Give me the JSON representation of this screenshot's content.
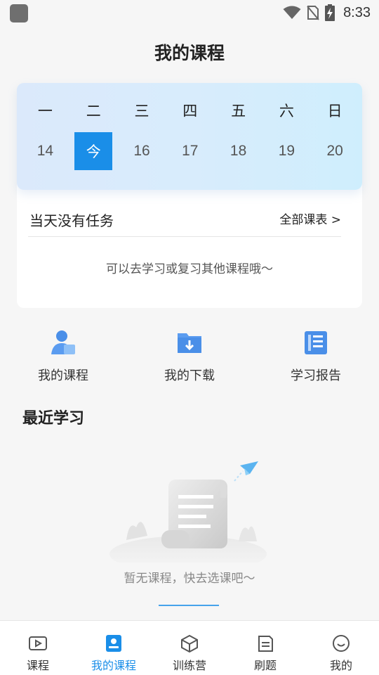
{
  "status_bar": {
    "time": "8:33"
  },
  "header": {
    "title": "我的课程"
  },
  "calendar": {
    "weekdays": [
      "一",
      "二",
      "三",
      "四",
      "五",
      "六",
      "日"
    ],
    "dates": [
      "14",
      "今",
      "16",
      "17",
      "18",
      "19",
      "20"
    ],
    "selected_index": 1
  },
  "task": {
    "title": "当天没有任务",
    "all_link": "全部课表 >",
    "hint": "可以去学习或复习其他课程哦～"
  },
  "quick_links": [
    {
      "label": "我的课程",
      "icon": "course-user-icon"
    },
    {
      "label": "我的下载",
      "icon": "download-folder-icon"
    },
    {
      "label": "学习报告",
      "icon": "report-icon"
    }
  ],
  "recent": {
    "title": "最近学习",
    "empty_text": "暂无课程，快去选课吧～"
  },
  "tabs": [
    {
      "label": "课程",
      "icon": "video-icon",
      "active": false
    },
    {
      "label": "我的课程",
      "icon": "my-course-icon",
      "active": true
    },
    {
      "label": "训练营",
      "icon": "cube-icon",
      "active": false
    },
    {
      "label": "刷题",
      "icon": "note-icon",
      "active": false
    },
    {
      "label": "我的",
      "icon": "smile-icon",
      "active": false
    }
  ],
  "colors": {
    "accent": "#1a8ee8",
    "icon_blue": "#5b9cf0"
  }
}
